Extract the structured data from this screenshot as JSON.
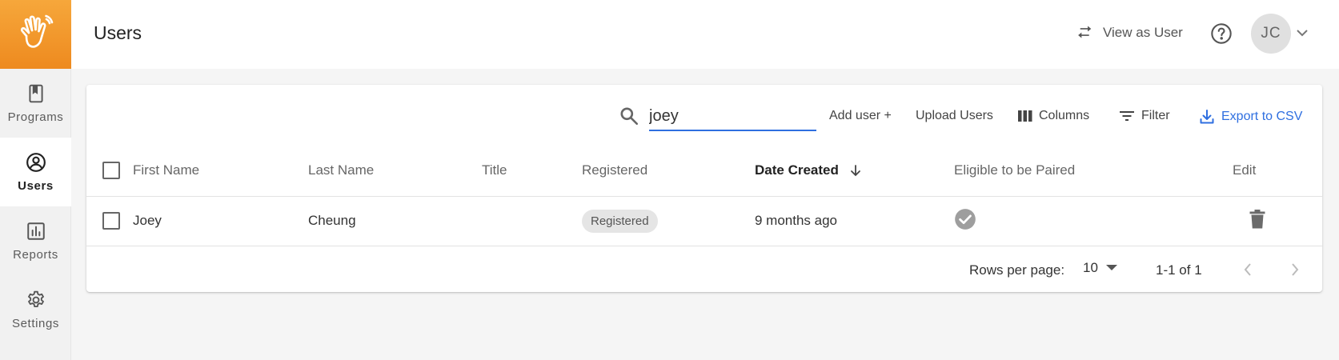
{
  "header": {
    "title": "Users",
    "view_as_label": "View as User",
    "avatar_initials": "JC"
  },
  "sidebar": {
    "items": [
      {
        "label": "Programs",
        "icon": "book-icon"
      },
      {
        "label": "Users",
        "icon": "account-circle-icon",
        "active": true
      },
      {
        "label": "Reports",
        "icon": "chart-icon"
      },
      {
        "label": "Settings",
        "icon": "gear-icon"
      }
    ]
  },
  "toolbar": {
    "search_value": "joey",
    "add_user": "Add user +",
    "upload_users": "Upload Users",
    "columns": "Columns",
    "filter": "Filter",
    "export": "Export to CSV"
  },
  "table": {
    "columns": [
      "First Name",
      "Last Name",
      "Title",
      "Registered",
      "Date Created",
      "Eligible to be Paired",
      "Edit"
    ],
    "sorted_column": "Date Created",
    "sort_direction": "descending",
    "rows": [
      {
        "first_name": "Joey",
        "last_name": "Cheung",
        "title": "",
        "registered": "Registered",
        "date_created": "9 months ago",
        "eligible": true
      }
    ]
  },
  "pagination": {
    "rows_per_page_label": "Rows per page:",
    "rows_per_page": "10",
    "range": "1-1 of 1"
  },
  "colors": {
    "brand_orange": "#f29a2e",
    "accent_blue": "#2f6fe0"
  }
}
